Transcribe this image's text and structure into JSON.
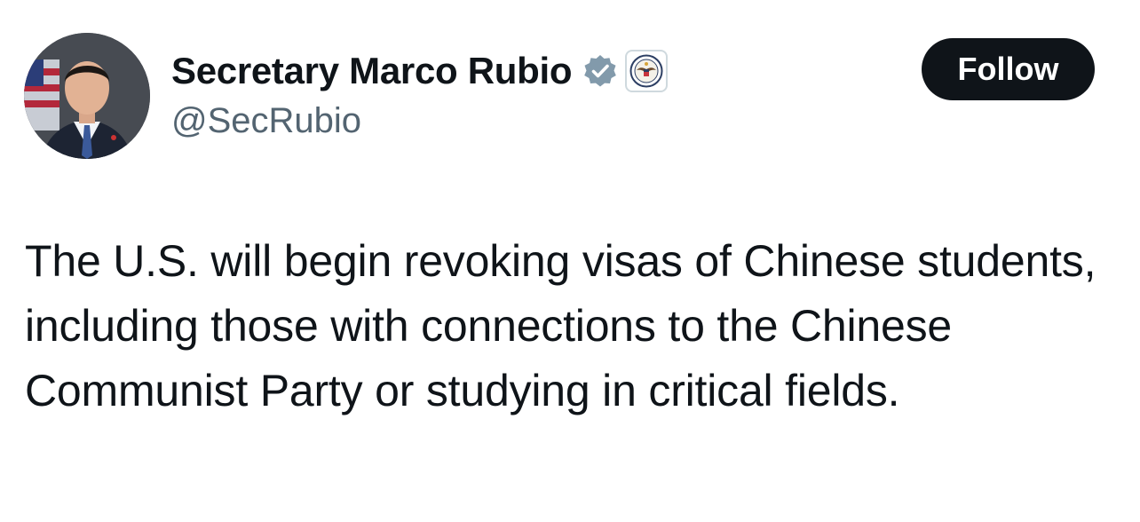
{
  "author": {
    "display_name": "Secretary Marco Rubio",
    "handle": "@SecRubio",
    "avatar_icon": "profile-photo",
    "verified_icon": "government-verified-badge-icon",
    "affiliate_icon": "state-department-seal-icon"
  },
  "follow_button": {
    "label": "Follow"
  },
  "tweet": {
    "text": "The U.S. will begin revoking visas of Chinese students, including those with connections to the Chinese Communist Party or studying in critical fields."
  },
  "colors": {
    "text_primary": "#0f1419",
    "text_secondary": "#536471",
    "verified_gray": "#829aab",
    "button_bg": "#0f1419",
    "button_text": "#ffffff"
  }
}
